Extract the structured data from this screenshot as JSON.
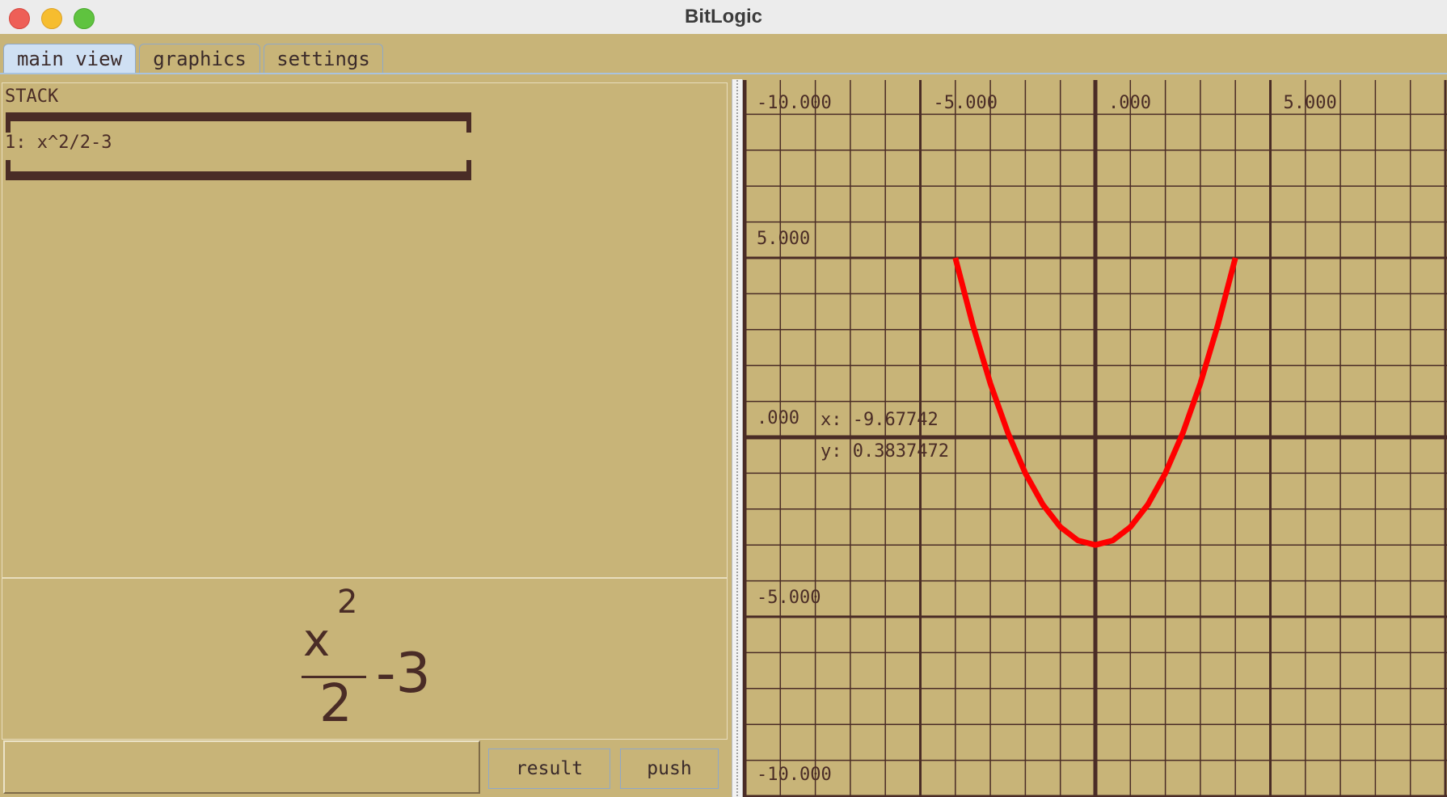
{
  "window": {
    "title": "BitLogic"
  },
  "tabs": [
    {
      "label": "main view",
      "active": true
    },
    {
      "label": "graphics",
      "active": false
    },
    {
      "label": "settings",
      "active": false
    }
  ],
  "stack": {
    "title": "STACK",
    "items": [
      {
        "label": "1: x^2/2-3"
      }
    ]
  },
  "preview": {
    "numerator": "x",
    "exponent": "2",
    "denominator": "2",
    "tail": "-3"
  },
  "input": {
    "value": ""
  },
  "buttons": {
    "result": "result",
    "push": "push"
  },
  "readout": {
    "x": "x: -9.67742",
    "y": "y: 0.3837472"
  },
  "colors": {
    "background": "#c8b478",
    "grid": "#4a2c26",
    "curve": "#ff0000",
    "active_tab": "#cfe0f3"
  },
  "chart_data": {
    "type": "line",
    "expression": "x^2/2-3",
    "series": [
      {
        "x": [
          -4.0,
          -3.5,
          -3.0,
          -2.5,
          -2.0,
          -1.5,
          -1.0,
          -0.5,
          0.0,
          0.5,
          1.0,
          1.5,
          2.0,
          2.5,
          3.0,
          3.5,
          4.0
        ],
        "y": [
          5.0,
          3.125,
          1.5,
          0.125,
          -1.0,
          -1.875,
          -2.5,
          -2.875,
          -3.0,
          -2.875,
          -2.5,
          -1.875,
          -1.0,
          0.125,
          1.5,
          3.125,
          5.0
        ]
      }
    ],
    "x_ticks": [
      "-10.000",
      "-5.000",
      ".000",
      "5.000"
    ],
    "y_ticks": [
      "5.000",
      ".000",
      "-5.000",
      "-10.000"
    ],
    "xlim": [
      -10,
      10
    ],
    "ylim": [
      -10,
      10
    ],
    "grid": true
  }
}
